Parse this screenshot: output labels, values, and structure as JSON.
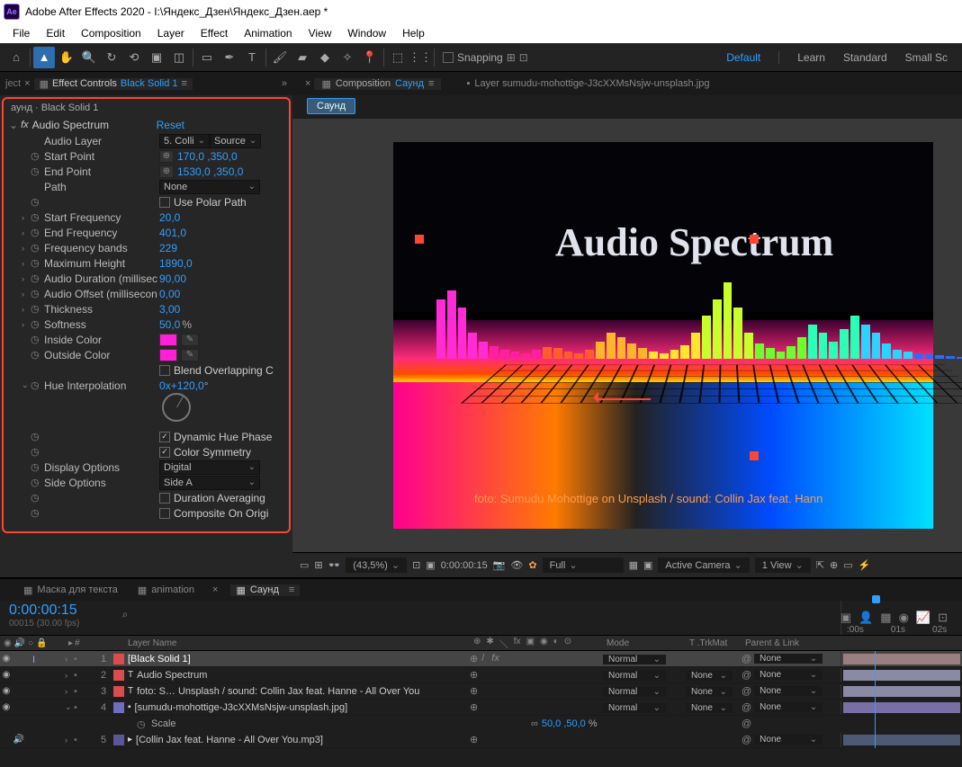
{
  "title": "Adobe After Effects 2020 - I:\\Яндекс_Дзен\\Яндекс_Дзен.aep *",
  "menu": [
    "File",
    "Edit",
    "Composition",
    "Layer",
    "Effect",
    "Animation",
    "View",
    "Window",
    "Help"
  ],
  "snapping": "Snapping",
  "workspaces": {
    "default": "Default",
    "learn": "Learn",
    "standard": "Standard",
    "small": "Small Sc"
  },
  "effectControls": {
    "tab_prefix": "Effect Controls",
    "tab_layer": "Black Solid 1",
    "breadcrumb": "аунд · Black Solid 1",
    "fx_name": "Audio Spectrum",
    "reset": "Reset",
    "props": {
      "audio_layer": {
        "label": "Audio Layer",
        "v1": "5. Colli",
        "v2": "Source"
      },
      "start_point": {
        "label": "Start Point",
        "val": "170,0 ,350,0"
      },
      "end_point": {
        "label": "End Point",
        "val": "1530,0 ,350,0"
      },
      "path": {
        "label": "Path",
        "val": "None"
      },
      "polar": {
        "label": "Use Polar Path"
      },
      "start_freq": {
        "label": "Start Frequency",
        "val": "20,0"
      },
      "end_freq": {
        "label": "End Frequency",
        "val": "401,0"
      },
      "bands": {
        "label": "Frequency bands",
        "val": "229"
      },
      "max_h": {
        "label": "Maximum Height",
        "val": "1890,0"
      },
      "duration": {
        "label": "Audio Duration (millisec",
        "val": "90,00"
      },
      "offset": {
        "label": "Audio Offset (millisecon",
        "val": "0,00"
      },
      "thickness": {
        "label": "Thickness",
        "val": "3,00"
      },
      "softness": {
        "label": "Softness",
        "val": "50,0",
        "unit": "%"
      },
      "inside": {
        "label": "Inside Color",
        "color": "#ff1fd8"
      },
      "outside": {
        "label": "Outside Color",
        "color": "#ff1fd8"
      },
      "blend": {
        "label": "Blend Overlapping C"
      },
      "hue": {
        "label": "Hue Interpolation",
        "v1": "0",
        "v2": "x+120,0",
        "unit": "°"
      },
      "dyn_hue": {
        "label": "Dynamic Hue Phase"
      },
      "color_sym": {
        "label": "Color Symmetry"
      },
      "display": {
        "label": "Display Options",
        "val": "Digital"
      },
      "side": {
        "label": "Side Options",
        "val": "Side A"
      },
      "dur_avg": {
        "label": "Duration Averaging"
      },
      "comp_orig": {
        "label": "Composite On Origi"
      }
    }
  },
  "comp": {
    "label": "Composition",
    "name": "Саунд",
    "layer_tab": "Layer sumudu-mohottige-J3cXXMsNsjw-unsplash.jpg",
    "chip": "Саунд",
    "viewer_title": "Audio Spectrum",
    "viewer_caption": "foto: Sumudu Mohottige on Unsplash / sound: Collin Jax feat. Hann"
  },
  "status": {
    "zoom": "(43,5%)",
    "time": "0:00:00:15",
    "quality": "Full",
    "camera": "Active Camera",
    "views": "1 View"
  },
  "timeline": {
    "tabs": [
      "Маска для текста",
      "animation",
      "Саунд"
    ],
    "timecode": "0:00:00:15",
    "fps": "00015 (30.00 fps)",
    "ruler": [
      ":00s",
      "01s",
      "02s"
    ],
    "cols": {
      "layername": "Layer Name",
      "mode": "Mode",
      "trk": "T .TrkMat",
      "parent": "Parent & Link",
      "idx": "#"
    },
    "layers": [
      {
        "idx": "1",
        "color": "#d94d4d",
        "name": "[Black Solid 1]",
        "mode": "Normal",
        "trk": "",
        "parent": "None",
        "sel": true,
        "bar": "#9a7f80"
      },
      {
        "idx": "2",
        "color": "#d94d4d",
        "icon": "T",
        "name": "Audio Spectrum",
        "mode": "Normal",
        "trk": "None",
        "parent": "None",
        "bar": "#8a8aa5"
      },
      {
        "idx": "3",
        "color": "#d94d4d",
        "icon": "T",
        "name": "foto: S… Unsplash / sound: Collin Jax feat. Hanne - All Over You",
        "mode": "Normal",
        "trk": "None",
        "parent": "None",
        "bar": "#8a8aa5"
      },
      {
        "idx": "4",
        "color": "#6e6ec0",
        "icon": "▪",
        "name": "[sumudu-mohottige-J3cXXMsNsjw-unsplash.jpg]",
        "mode": "Normal",
        "trk": "None",
        "parent": "None",
        "bar": "#7a6fa5",
        "expanded": true
      },
      {
        "idx": "5",
        "color": "#585898",
        "icon": "▸",
        "name": "[Collin Jax feat. Hanne - All Over You.mp3]",
        "mode": "",
        "trk": "",
        "parent": "None",
        "bar": "#4d5a73",
        "audio": true
      }
    ],
    "scale": {
      "label": "Scale",
      "val": "50,0 ,50,0",
      "unit": "%"
    }
  }
}
